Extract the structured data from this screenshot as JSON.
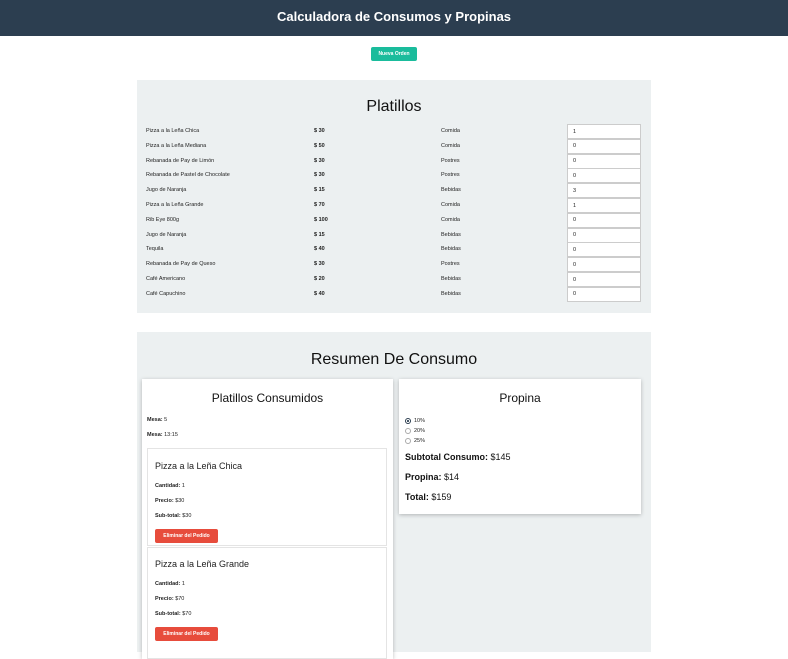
{
  "header": {
    "title": "Calculadora de Consumos y Propinas"
  },
  "actions": {
    "new_order": "Nueva Orden"
  },
  "dishes": {
    "title": "Platillos",
    "items": [
      {
        "name": "Pizza a la Leña Chica",
        "price": "$ 30",
        "category": "Comida",
        "qty": "1"
      },
      {
        "name": "Pizza a la Leña Mediana",
        "price": "$ 50",
        "category": "Comida",
        "qty": "0"
      },
      {
        "name": "Rebanada de Pay de Limón",
        "price": "$ 30",
        "category": "Postres",
        "qty": "0"
      },
      {
        "name": "Rebanada de Pastel de Chocolate",
        "price": "$ 30",
        "category": "Postres",
        "qty": "0"
      },
      {
        "name": "Jugo de Naranja",
        "price": "$ 15",
        "category": "Bebidas",
        "qty": "3"
      },
      {
        "name": "Pizza a la Leña Grande",
        "price": "$ 70",
        "category": "Comida",
        "qty": "1"
      },
      {
        "name": "Rib Eye 800g",
        "price": "$ 100",
        "category": "Comida",
        "qty": "0"
      },
      {
        "name": "Jugo de Naranja",
        "price": "$ 15",
        "category": "Bebidas",
        "qty": "0"
      },
      {
        "name": "Tequila",
        "price": "$ 40",
        "category": "Bebidas",
        "qty": "0"
      },
      {
        "name": "Rebanada de Pay de Queso",
        "price": "$ 30",
        "category": "Postres",
        "qty": "0"
      },
      {
        "name": "Café Americano",
        "price": "$ 20",
        "category": "Bebidas",
        "qty": "0"
      },
      {
        "name": "Café Capuchino",
        "price": "$ 40",
        "category": "Bebidas",
        "qty": "0"
      }
    ]
  },
  "summary": {
    "title": "Resumen De Consumo",
    "consumed": {
      "title": "Platillos Consumidos",
      "mesa_label": "Mesa:",
      "mesa_value": "5",
      "hora_label": "Mesa:",
      "hora_value": "13:15",
      "items": [
        {
          "name": "Pizza a la Leña Chica",
          "qty_label": "Cantidad:",
          "qty": "1",
          "price_label": "Precio:",
          "price": "$30",
          "subtotal_label": "Sub-total:",
          "subtotal": "$30",
          "remove": "Eliminar del Pedido"
        },
        {
          "name": "Pizza a la Leña Grande",
          "qty_label": "Cantidad:",
          "qty": "1",
          "price_label": "Precio:",
          "price": "$70",
          "subtotal_label": "Sub-total:",
          "subtotal": "$70",
          "remove": "Eliminar del Pedido"
        }
      ]
    },
    "tip": {
      "title": "Propina",
      "options": [
        {
          "label": "10%",
          "selected": true
        },
        {
          "label": "20%",
          "selected": false
        },
        {
          "label": "25%",
          "selected": false
        }
      ],
      "subtotal_label": "Subtotal Consumo:",
      "subtotal_value": "$145",
      "tip_label": "Propina:",
      "tip_value": "$14",
      "total_label": "Total:",
      "total_value": "$159"
    }
  },
  "colors": {
    "header": "#2c3e50",
    "accent_green": "#1abc9c",
    "danger_red": "#e74c3c",
    "panel_bg": "#ecf0f1"
  }
}
